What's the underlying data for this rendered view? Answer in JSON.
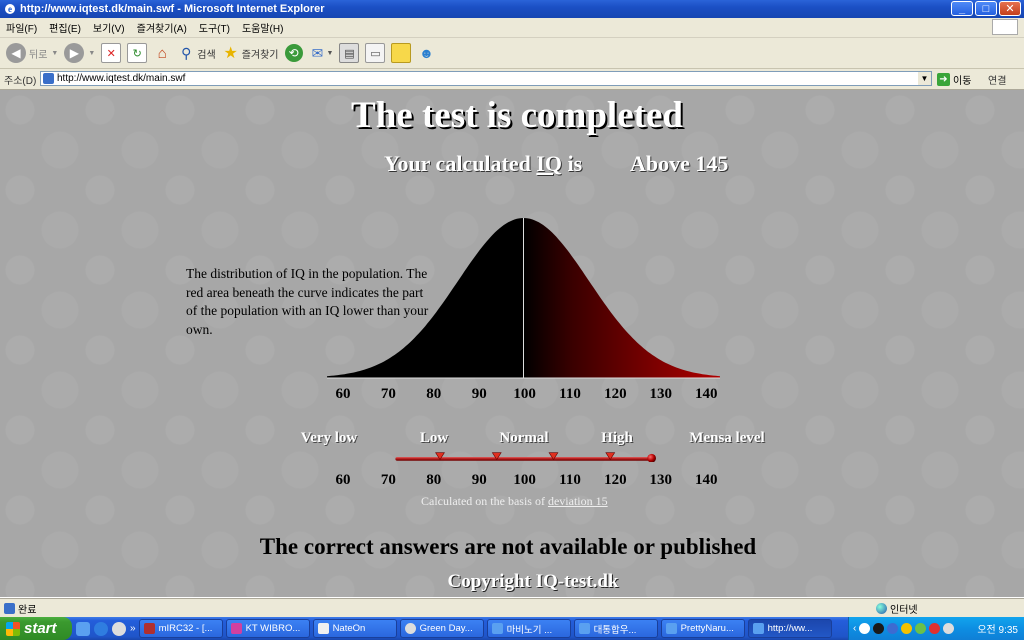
{
  "window": {
    "title": "http://www.iqtest.dk/main.swf - Microsoft Internet Explorer",
    "controls": [
      "_",
      "□",
      "✕"
    ]
  },
  "menu": [
    "파일(F)",
    "편집(E)",
    "보기(V)",
    "즐겨찾기(A)",
    "도구(T)",
    "도움말(H)"
  ],
  "toolbar": {
    "back_label": "뒤로",
    "search_label": "검색",
    "favorites_label": "즐겨찾기"
  },
  "address": {
    "label": "주소(D)",
    "url": "http://www.iqtest.dk/main.swf",
    "go_label": "이동",
    "links_label": "연결"
  },
  "page": {
    "title": "The test is completed",
    "iq_prefix": "Your calculated ",
    "iq_abbrev": "IQ",
    "iq_suffix": " is",
    "iq_value": "Above 145",
    "description": "The distribution of IQ in the population. The red area beneath the curve indicates the part of the population with an IQ lower than your own.",
    "axis_ticks": [
      "60",
      "70",
      "80",
      "90",
      "100",
      "110",
      "120",
      "130",
      "140"
    ],
    "levels": [
      "Very low",
      "Low",
      "Normal",
      "High",
      "Mensa level"
    ],
    "marker_values": [
      70,
      90,
      110,
      130
    ],
    "scale_result": 145,
    "basis_prefix": "Calculated on the basis of ",
    "basis_link": "deviation 15",
    "no_answers": "The correct answers are not available or published",
    "copyright": "Copyright IQ-test.dk",
    "colors": {
      "dark_fill": "#000000",
      "red_fill": "#b00000",
      "scale_bar": "#b01818"
    }
  },
  "status": {
    "done_label": "완료",
    "zone_label": "인터넷"
  },
  "taskbar": {
    "start_label": "start",
    "tasks": [
      "mIRC32 - [...",
      "KT WIBRO...",
      "NateOn",
      "Green Day...",
      "마비노기 ...",
      "대통합우...",
      "PrettyNaru...",
      "http://ww..."
    ],
    "clock": "오전 9:35"
  }
}
